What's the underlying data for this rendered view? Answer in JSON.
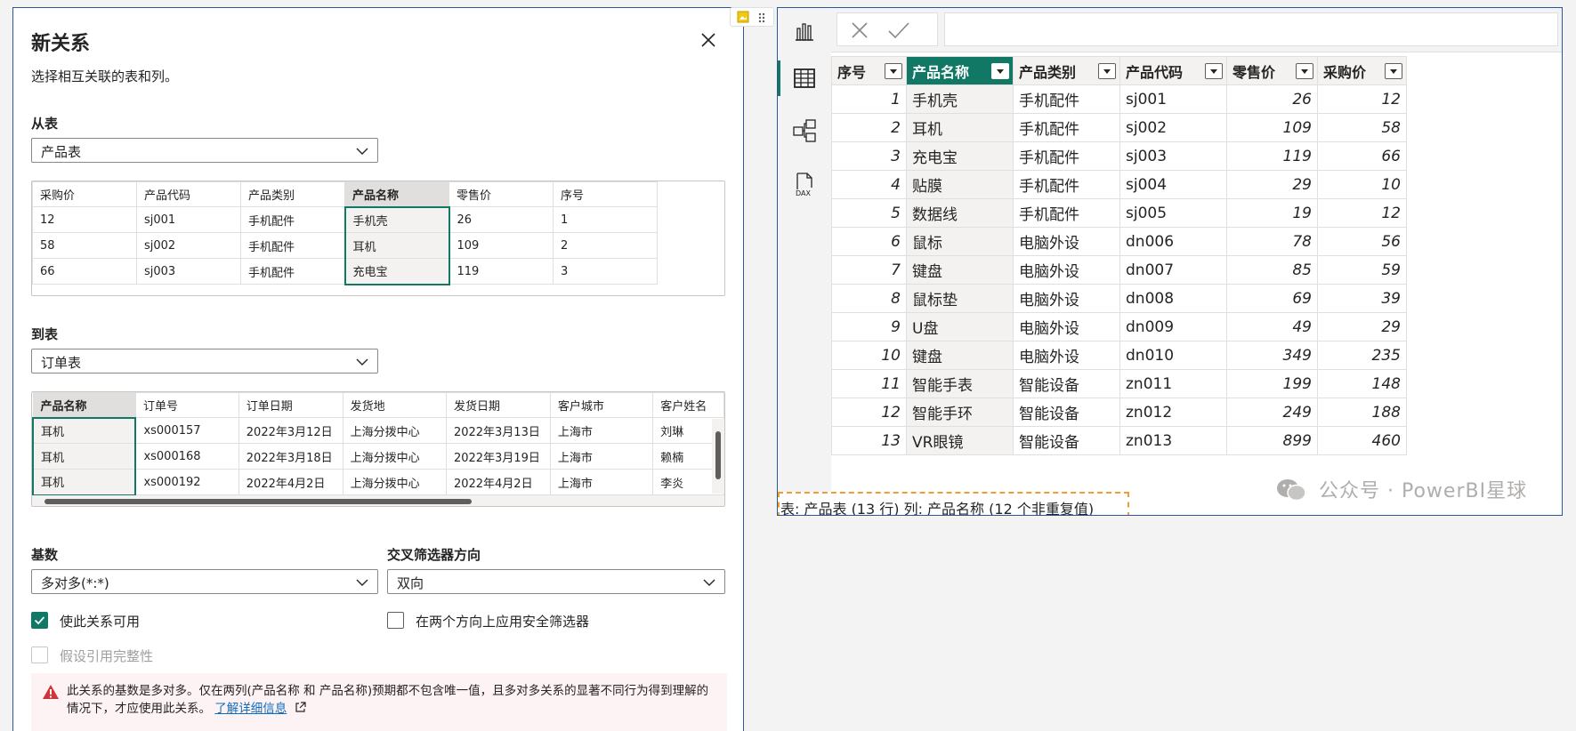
{
  "dialog": {
    "title": "新关系",
    "subtitle": "选择相互关联的表和列。",
    "from": {
      "label": "从表",
      "table": "产品表",
      "columns": [
        "采购价",
        "产品代码",
        "产品类别",
        "产品名称",
        "零售价",
        "序号"
      ],
      "rows": [
        [
          "12",
          "sj001",
          "手机配件",
          "手机壳",
          "26",
          "1"
        ],
        [
          "58",
          "sj002",
          "手机配件",
          "耳机",
          "109",
          "2"
        ],
        [
          "66",
          "sj003",
          "手机配件",
          "充电宝",
          "119",
          "3"
        ]
      ]
    },
    "to": {
      "label": "到表",
      "table": "订单表",
      "columns": [
        "产品名称",
        "订单号",
        "订单日期",
        "发货地",
        "发货日期",
        "客户城市",
        "客户姓名"
      ],
      "rows": [
        [
          "耳机",
          "xs000157",
          "2022年3月12日",
          "上海分拨中心",
          "2022年3月13日",
          "上海市",
          "刘琳"
        ],
        [
          "耳机",
          "xs000168",
          "2022年3月18日",
          "上海分拨中心",
          "2022年3月19日",
          "上海市",
          "赖楠"
        ],
        [
          "耳机",
          "xs000192",
          "2022年4月2日",
          "上海分拨中心",
          "2022年4月2日",
          "上海市",
          "李炎"
        ]
      ]
    },
    "cardinality": {
      "label": "基数",
      "value": "多对多(*:*)"
    },
    "crossfilter": {
      "label": "交叉筛选器方向",
      "value": "双向"
    },
    "checkboxes": {
      "active": "使此关系可用",
      "security": "在两个方向上应用安全筛选器",
      "integrity": "假设引用完整性"
    },
    "warning": {
      "text": "此关系的基数是多对多。仅在两列(产品名称 和 产品名称)预期都不包含唯一值，且多对多关系的显著不同行为得到理解的情况下，才应使用此关系。",
      "link": "了解详细信息"
    }
  },
  "data_view": {
    "columns": [
      "序号",
      "产品名称",
      "产品类别",
      "产品代码",
      "零售价",
      "采购价"
    ],
    "rows": [
      [
        "1",
        "手机壳",
        "手机配件",
        "sj001",
        "26",
        "12"
      ],
      [
        "2",
        "耳机",
        "手机配件",
        "sj002",
        "109",
        "58"
      ],
      [
        "3",
        "充电宝",
        "手机配件",
        "sj003",
        "119",
        "66"
      ],
      [
        "4",
        "贴膜",
        "手机配件",
        "sj004",
        "29",
        "10"
      ],
      [
        "5",
        "数据线",
        "手机配件",
        "sj005",
        "19",
        "12"
      ],
      [
        "6",
        "鼠标",
        "电脑外设",
        "dn006",
        "78",
        "56"
      ],
      [
        "7",
        "键盘",
        "电脑外设",
        "dn007",
        "85",
        "59"
      ],
      [
        "8",
        "鼠标垫",
        "电脑外设",
        "dn008",
        "69",
        "39"
      ],
      [
        "9",
        "U盘",
        "电脑外设",
        "dn009",
        "49",
        "29"
      ],
      [
        "10",
        "键盘",
        "电脑外设",
        "dn010",
        "349",
        "235"
      ],
      [
        "11",
        "智能手表",
        "智能设备",
        "zn011",
        "199",
        "148"
      ],
      [
        "12",
        "智能手环",
        "智能设备",
        "zn012",
        "249",
        "188"
      ],
      [
        "13",
        "VR眼镜",
        "智能设备",
        "zn013",
        "899",
        "460"
      ]
    ],
    "status": "表: 产品表 (13 行) 列: 产品名称 (12 个非重复值)",
    "watermark": "公众号 · PowerBI星球"
  },
  "colors": {
    "accent": "#117865",
    "border_blue": "#2b579a",
    "warning_red": "#d13438",
    "dashed_orange": "#f29b2f"
  }
}
